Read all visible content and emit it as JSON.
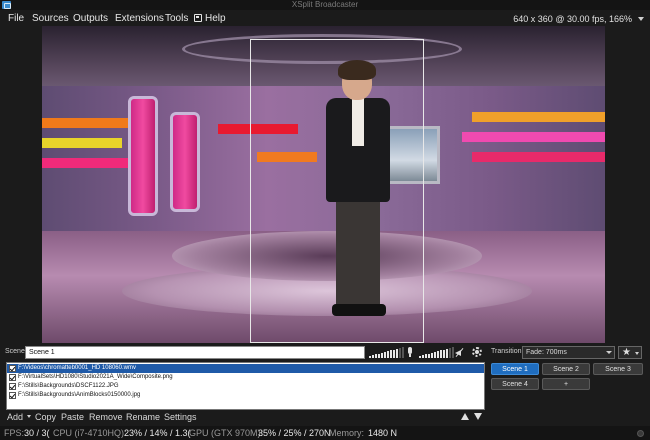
{
  "window": {
    "title": "XSplit Broadcaster"
  },
  "menu": {
    "items": [
      "File",
      "Sources",
      "Outputs",
      "Extensions",
      "Tools"
    ],
    "help_label": "Help"
  },
  "resolution": {
    "text": "640 x 360 @ 30.00 fps, 166%"
  },
  "scene_bar": {
    "label": "Scene",
    "scene_name": "Scene 1",
    "transition_label": "Transition",
    "transition_value": "Fade: 700ms",
    "speaker_level": 0.85,
    "mic_level": 0.85
  },
  "sources": [
    {
      "path": "F:\\Videos\\chromatteb0001_HD 108060.wmv",
      "checked": true,
      "selected": true
    },
    {
      "path": "F:\\VirtualSets\\HD1080\\Studio2021A_Wide\\Composite.png",
      "checked": true,
      "selected": false
    },
    {
      "path": "F:\\Stills\\Backgrounds\\DSCF1122.JPG",
      "checked": true,
      "selected": false
    },
    {
      "path": "F:\\Stills\\Backgrounds\\AnimBlocks0150000.jpg",
      "checked": true,
      "selected": false
    }
  ],
  "source_toolbar": {
    "add": "Add",
    "copy": "Copy",
    "paste": "Paste",
    "remove": "Remove",
    "rename": "Rename",
    "settings": "Settings"
  },
  "scenes": [
    {
      "label": "Scene 1",
      "active": true
    },
    {
      "label": "Scene 2",
      "active": false
    },
    {
      "label": "Scene 3",
      "active": false
    },
    {
      "label": "Scene 4",
      "active": false
    },
    {
      "label": "+",
      "active": false
    }
  ],
  "status": {
    "fps_label": "FPS:",
    "fps_value": "30 / 3(",
    "cpu_label": "CPU (i7-4710HQ):",
    "cpu_value": "23% / 14% / 1.3(",
    "gpu_label": "GPU (GTX 970M):",
    "gpu_value": "35% / 25% / 270N",
    "memory_label": "Memory:",
    "memory_value": "1480 N"
  },
  "colors": {
    "accent": "#1f6dbf",
    "selection": "#1f5aa8",
    "background": "#1b1b1b"
  }
}
